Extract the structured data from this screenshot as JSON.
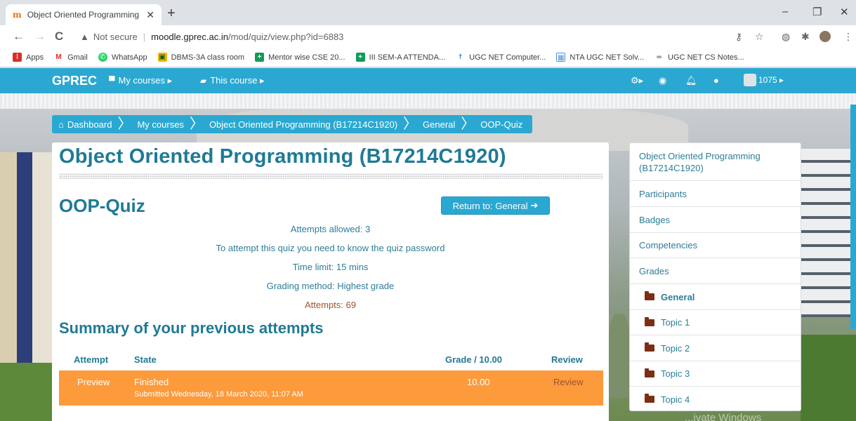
{
  "browser": {
    "tab_title": "Object Oriented Programming (B",
    "tab_close": "✕",
    "new_tab": "+",
    "favicon": "m",
    "window": {
      "minimize": "–",
      "restore": "❐",
      "close": "✕"
    },
    "nav": {
      "back": "←",
      "forward": "→",
      "reload": "C"
    },
    "security_label": "Not secure",
    "url_host": "moodle.gprec.ac.in",
    "url_path": "/mod/quiz/view.php?id=6883",
    "bookmarks": [
      {
        "label": "Apps",
        "icon": "apps-grid-icon",
        "color": "#d93025"
      },
      {
        "label": "Gmail",
        "icon": "gmail-icon",
        "color": "#d93025"
      },
      {
        "label": "WhatsApp",
        "icon": "whatsapp-icon",
        "color": "#25d366"
      },
      {
        "label": "DBMS-3A class room",
        "icon": "classroom-icon",
        "color": "#f4b400"
      },
      {
        "label": "Mentor wise CSE 20...",
        "icon": "sheets-icon",
        "color": "#0f9d58"
      },
      {
        "label": "III SEM-A ATTENDA...",
        "icon": "sheets-icon",
        "color": "#0f9d58"
      },
      {
        "label": "UGC NET Computer...",
        "icon": "person-icon",
        "color": "#1a73e8"
      },
      {
        "label": "NTA UGC NET Solv...",
        "icon": "calendar-icon",
        "color": "#4a90d9"
      },
      {
        "label": "UGC NET CS Notes...",
        "icon": "link-icon",
        "color": "#5f6368"
      }
    ]
  },
  "navbar": {
    "brand": "GPREC",
    "my_courses": "My courses ▸",
    "this_course": "This course ▸",
    "user_label": "1075 ▸",
    "colors": {
      "bar": "#2aa8d2"
    }
  },
  "breadcrumb": [
    {
      "label": "Dashboard"
    },
    {
      "label": "My courses"
    },
    {
      "label": "Object Oriented Programming (B17214C1920)"
    },
    {
      "label": "General"
    },
    {
      "label": "OOP-Quiz"
    }
  ],
  "main": {
    "course_title": "Object Oriented Programming (B17214C1920)",
    "quiz_title": "OOP-Quiz",
    "return_button": "Return to: General",
    "info": {
      "attempts_allowed": "Attempts allowed: 3",
      "password_note": "To attempt this quiz you need to know the quiz password",
      "time_limit": "Time limit: 15 mins",
      "grading_method": "Grading method: Highest grade",
      "attempts_count": "Attempts: 69"
    },
    "summary_heading": "Summary of your previous attempts",
    "table": {
      "headers": {
        "attempt": "Attempt",
        "state": "State",
        "grade": "Grade / 10.00",
        "review": "Review"
      },
      "rows": [
        {
          "attempt": "Preview",
          "state": "Finished",
          "submitted": "Submitted Wednesday, 18 March 2020, 11:07 AM",
          "grade": "10.00",
          "review": "Review"
        }
      ]
    }
  },
  "sidebar": {
    "items": [
      {
        "label": "Object Oriented Programming (B17214C1920)"
      },
      {
        "label": "Participants"
      },
      {
        "label": "Badges"
      },
      {
        "label": "Competencies"
      },
      {
        "label": "Grades"
      }
    ],
    "sections": [
      {
        "label": "General",
        "current": true
      },
      {
        "label": "Topic 1"
      },
      {
        "label": "Topic 2"
      },
      {
        "label": "Topic 3"
      },
      {
        "label": "Topic 4"
      }
    ]
  },
  "watermark": "...ivate Windows"
}
